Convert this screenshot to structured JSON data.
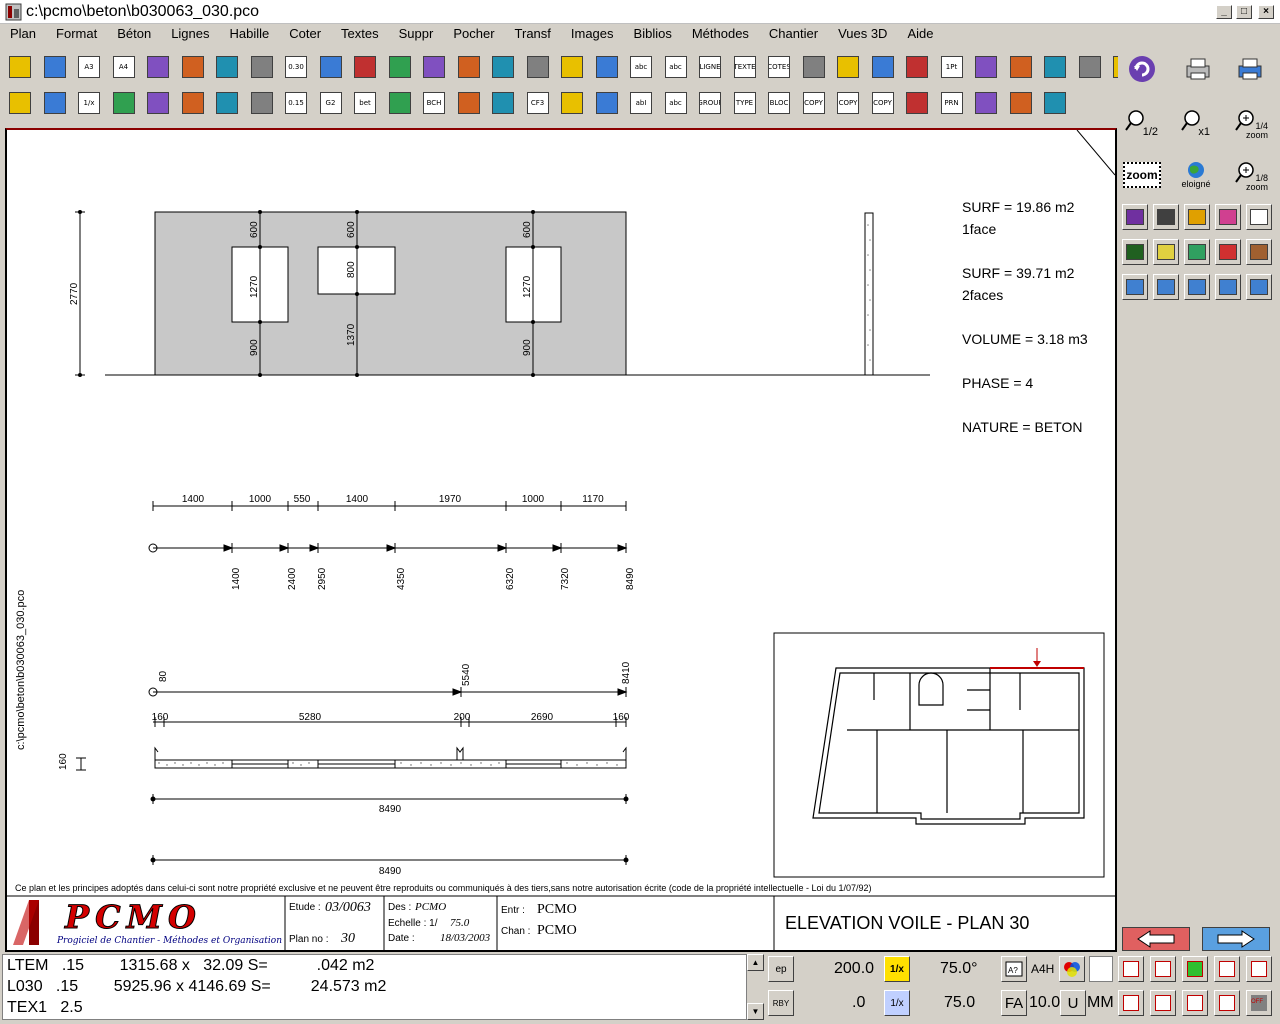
{
  "window": {
    "title": "c:\\pcmo\\beton\\b030063_030.pco",
    "min_label": "_",
    "max_label": "□",
    "close_label": "×"
  },
  "menu": [
    "Plan",
    "Format",
    "Béton",
    "Lignes",
    "Habille",
    "Coter",
    "Textes",
    "Suppr",
    "Pocher",
    "Transf",
    "Images",
    "Biblios",
    "Méthodes",
    "Chantier",
    "Vues 3D",
    "Aide"
  ],
  "toolbar": {
    "row1": [
      "",
      "",
      "A3",
      "A4",
      "",
      "",
      "",
      "",
      "0.30",
      "",
      "",
      "",
      "",
      "",
      "",
      "",
      "",
      "",
      "abc",
      "abc",
      "LIGNE",
      "TEXTE",
      "COTES",
      "",
      "",
      "",
      "",
      "1Pt",
      "",
      "",
      "",
      "",
      ""
    ],
    "row2": [
      "",
      "",
      "1/x",
      "",
      "",
      "",
      "",
      "",
      "0.15",
      "G2",
      "bet",
      "",
      "BCH",
      "",
      "",
      "CF3",
      "",
      "",
      "abI",
      "abc",
      "GROUP",
      "TYPE",
      "BLOC",
      "COPY",
      "COPY",
      "COPY",
      "",
      "PRN",
      "",
      "",
      ""
    ]
  },
  "right_panel": {
    "zoom_half": "1/2",
    "zoom_x1": "x1",
    "zoom_quarter": "1/4 zoom",
    "zoom_label": "zoom",
    "eloigne_label": "eloigné",
    "zoom_eighth": "1/8 zoom"
  },
  "drawing": {
    "info": {
      "surf1": "SURF =  19.86 m2",
      "surf1_sub": "1face",
      "surf2": "SURF =  39.71 m2",
      "surf2_sub": "2faces",
      "volume": "VOLUME =    3.18 m3",
      "phase": "PHASE  = 4",
      "nature": "NATURE = BETON"
    },
    "elevation": {
      "height_dim": "2770",
      "dims": [
        "600",
        "1270",
        "900",
        "600",
        "800",
        "1370",
        "600",
        "1270",
        "900"
      ]
    },
    "partial_dims": [
      "1400",
      "1000",
      "550",
      "1400",
      "1970",
      "1000",
      "1170"
    ],
    "cumulative_dims": [
      "1400",
      "2400",
      "2950",
      "4350",
      "6320",
      "7320",
      "8490"
    ],
    "top_dims": [
      "80",
      "5540",
      "8410"
    ],
    "opening_dims": [
      "160",
      "5280",
      "200",
      "2690",
      "160"
    ],
    "side_dim": "160",
    "total_dim_1": "8490",
    "total_dim_2": "8490",
    "side_path": "c:\\pcmo\\beton\\b030063_030.pco",
    "copyright": "Ce plan et les principes adoptés dans celui-ci sont notre propriété exclusive et ne peuvent être reproduits ou communiqués à des tiers,sans notre autorisation écrite (code de la propriété intellectuelle - Loi du 1/07/92)",
    "cartouche": {
      "logo_text": "PCMO",
      "logo_sub": "Progiciel de Chantier - Méthodes et Organisation",
      "etude_label": "Etude :",
      "etude_value": "03/0063",
      "plan_label": "Plan no :",
      "plan_value": "30",
      "des_label": "Des :",
      "des_value": "PCMO",
      "echelle_label": "Echelle :  1/",
      "echelle_value": "75.0",
      "date_label": "Date :",
      "date_value": "18/03/2003",
      "entr_label": "Entr :",
      "entr_value": "PCMO",
      "chan_label": "Chan :",
      "chan_value": "PCMO",
      "title": "ELEVATION VOILE - PLAN 30"
    }
  },
  "status": {
    "row1": "LTEM   .15        1315.68 x   32.09 S=           .042 m2",
    "row2": "L030   .15        5925.96 x 4146.69 S=         24.573 m2",
    "row3": "TEX1   2.5",
    "ep_label": "ep",
    "val_200": "200.0",
    "val_75deg": "75.0°",
    "a4h": "A4H",
    "rby_label": "RBY",
    "val_0": ".0",
    "val_75": "75.0",
    "fa_label": "FA",
    "val_10": "10.0",
    "u_label": "U",
    "mm_label": "MM",
    "onex_label": "1/x",
    "off_label": "OFF"
  }
}
